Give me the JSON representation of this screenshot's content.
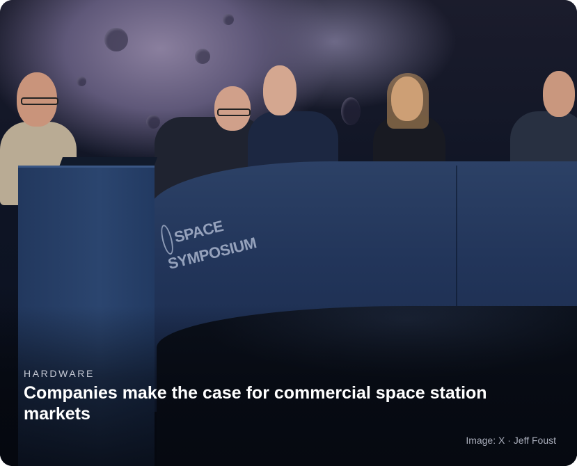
{
  "card": {
    "category": "HARDWARE",
    "headline": "Companies make the case for commercial space station markets",
    "credit": "Image: X · Jeff Foust"
  },
  "photo": {
    "desk_logo_text": "SPACE SYMPOSIUM"
  },
  "colors": {
    "caption_text": "#ffffff",
    "category_text": "#c7cbd6",
    "credit_text": "#a9aebb",
    "desk_blue": "#22355a"
  }
}
